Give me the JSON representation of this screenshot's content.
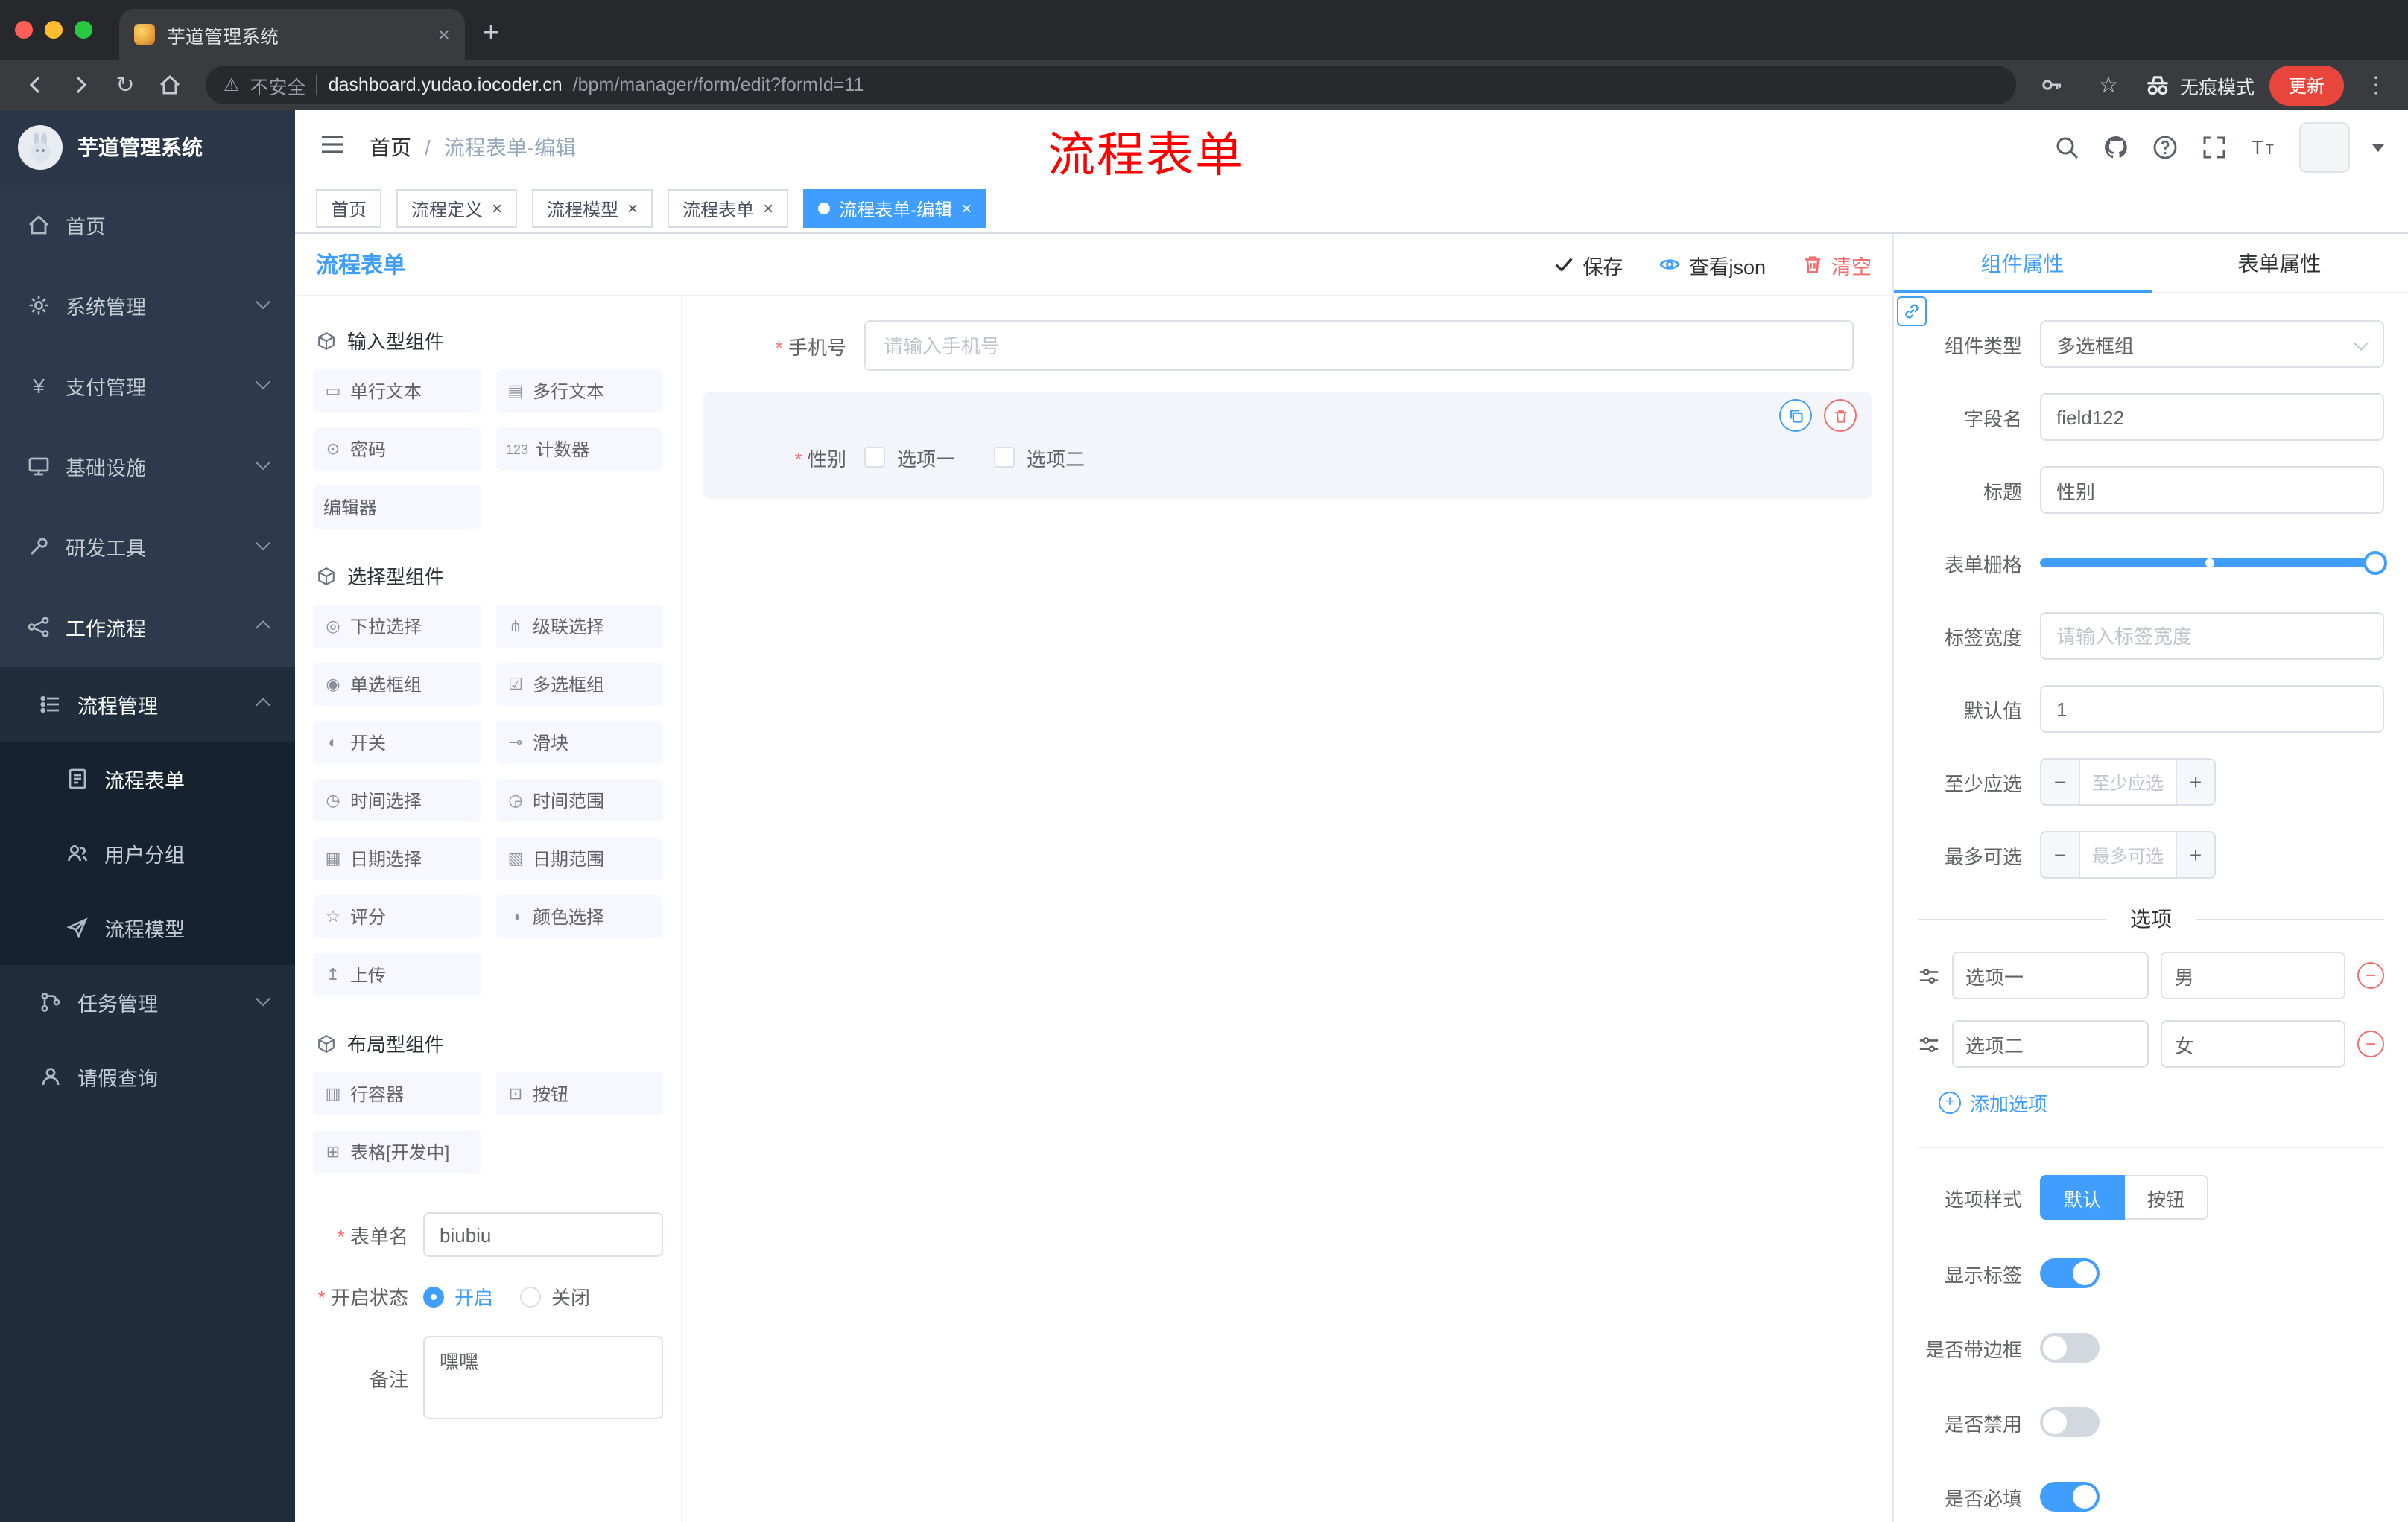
{
  "colors": {
    "accent": "#409eff",
    "danger": "#f56c6c",
    "annotation_red": "#ff0000"
  },
  "browser": {
    "tab_title": "芋道管理系统",
    "security_label": "不安全",
    "url_domain": "dashboard.yudao.iocoder.cn",
    "url_path": "/bpm/manager/form/edit?formId=11",
    "incognito_label": "无痕模式",
    "update_label": "更新"
  },
  "sidebar": {
    "logo_title": "芋道管理系统",
    "top_items": [
      "首页",
      "系统管理",
      "支付管理",
      "基础设施",
      "研发工具"
    ],
    "workflow_label": "工作流程",
    "process_mgmt_label": "流程管理",
    "process_children": [
      "流程表单",
      "用户分组",
      "流程模型"
    ],
    "task_mgmt_label": "任务管理",
    "leave_query_label": "请假查询"
  },
  "header": {
    "breadcrumb_home": "首页",
    "breadcrumb_sep": "/",
    "breadcrumb_current": "流程表单-编辑",
    "annotation": "流程表单"
  },
  "tags": [
    {
      "label": "首页"
    },
    {
      "label": "流程定义"
    },
    {
      "label": "流程模型"
    },
    {
      "label": "流程表单"
    },
    {
      "label": "流程表单-编辑"
    }
  ],
  "designer": {
    "panel_title": "流程表单",
    "actions": {
      "save": "保存",
      "view_json": "查看json",
      "clear": "清空"
    },
    "palette": {
      "groups": [
        {
          "title": "输入型组件",
          "items": [
            {
              "icon": "▭",
              "label": "单行文本"
            },
            {
              "icon": "▤",
              "label": "多行文本"
            },
            {
              "icon": "⊙",
              "label": "密码"
            },
            {
              "icon": "123",
              "label": "计数器"
            },
            {
              "icon": "",
              "label": "编辑器"
            }
          ]
        },
        {
          "title": "选择型组件",
          "items": [
            {
              "icon": "◎",
              "label": "下拉选择"
            },
            {
              "icon": "⋔",
              "label": "级联选择"
            },
            {
              "icon": "◉",
              "label": "单选框组"
            },
            {
              "icon": "☑",
              "label": "多选框组"
            },
            {
              "icon": "◐",
              "label": "开关"
            },
            {
              "icon": "⊸",
              "label": "滑块"
            },
            {
              "icon": "◷",
              "label": "时间选择"
            },
            {
              "icon": "◶",
              "label": "时间范围"
            },
            {
              "icon": "▦",
              "label": "日期选择"
            },
            {
              "icon": "▧",
              "label": "日期范围"
            },
            {
              "icon": "☆",
              "label": "评分"
            },
            {
              "icon": "◑",
              "label": "颜色选择"
            },
            {
              "icon": "↥",
              "label": "上传"
            }
          ]
        },
        {
          "title": "布局型组件",
          "items": [
            {
              "icon": "▥",
              "label": "行容器"
            },
            {
              "icon": "⊡",
              "label": "按钮"
            },
            {
              "icon": "⊞",
              "label": "表格[开发中]"
            }
          ]
        }
      ]
    },
    "meta": {
      "form_name_label": "表单名",
      "form_name_value": "biubiu",
      "status_label": "开启状态",
      "status_on": "开启",
      "status_off": "关闭",
      "remark_label": "备注",
      "remark_value": "嘿嘿"
    },
    "canvas": {
      "phone_label": "手机号",
      "phone_placeholder": "请输入手机号",
      "gender_label": "性别",
      "gender_option_1": "选项一",
      "gender_option_2": "选项二"
    }
  },
  "props": {
    "tab_component": "组件属性",
    "tab_form": "表单属性",
    "component_type_label": "组件类型",
    "component_type_value": "多选框组",
    "field_name_label": "字段名",
    "field_name_value": "field122",
    "title_label": "标题",
    "title_value": "性别",
    "grid_label": "表单栅格",
    "label_width_label": "标签宽度",
    "label_width_placeholder": "请输入标签宽度",
    "default_label": "默认值",
    "default_value": "1",
    "min_label": "至少应选",
    "min_placeholder": "至少应选",
    "max_label": "最多可选",
    "max_placeholder": "最多可选",
    "options_divider": "选项",
    "option_rows": [
      {
        "label": "选项一",
        "value": "男"
      },
      {
        "label": "选项二",
        "value": "女"
      }
    ],
    "add_option": "添加选项",
    "option_style_label": "选项样式",
    "style_default": "默认",
    "style_button": "按钮",
    "switch_show_label": "显示标签",
    "switch_border": "是否带边框",
    "switch_disabled": "是否禁用",
    "switch_required": "是否必填"
  }
}
